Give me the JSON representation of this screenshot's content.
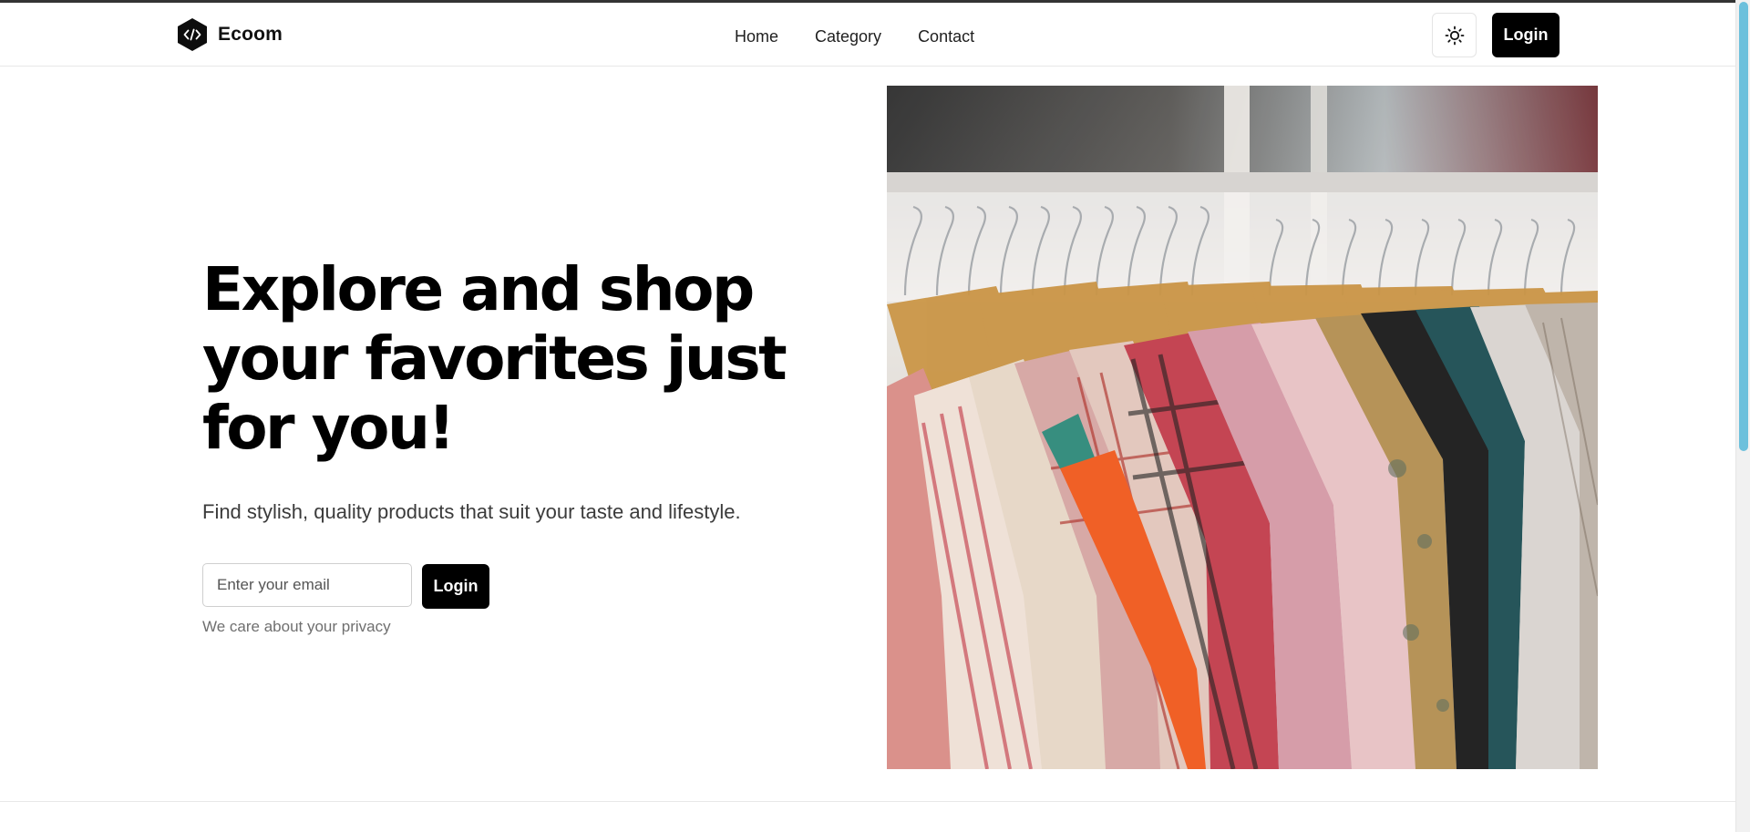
{
  "brand": {
    "name": "Ecoom",
    "logo_icon": "code-hexagon-icon"
  },
  "nav": {
    "items": [
      {
        "label": "Home"
      },
      {
        "label": "Category"
      },
      {
        "label": "Contact"
      }
    ]
  },
  "header": {
    "theme_toggle_icon": "sun-icon",
    "login_label": "Login"
  },
  "hero": {
    "title": "Explore and shop your favorites just for you!",
    "subtitle": "Find stylish, quality products that suit your taste and lifestyle.",
    "email_placeholder": "Enter your email",
    "login_label": "Login",
    "privacy_note": "We care about your privacy",
    "image_subject": "clothes-rack-photo"
  },
  "colors": {
    "primary": "#000000",
    "background": "#ffffff",
    "scrollbar_thumb": "#6cc0dc"
  }
}
